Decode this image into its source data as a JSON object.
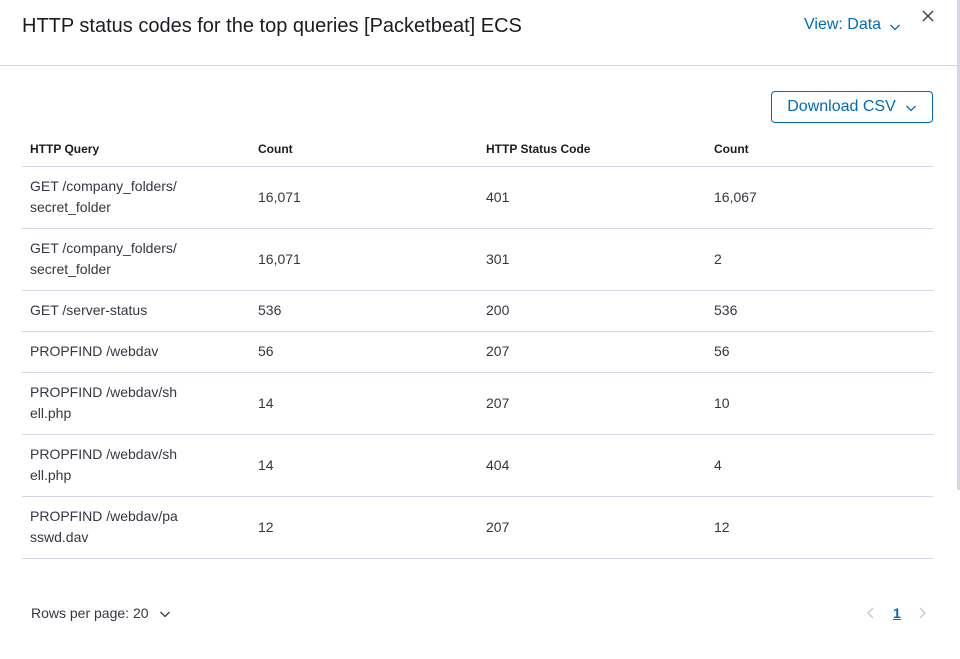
{
  "header": {
    "title": "HTTP status codes for the top queries [Packetbeat] ECS",
    "view_label": "View: Data",
    "close_icon": "close-icon",
    "chevron_icon": "chevron-down-icon"
  },
  "toolbar": {
    "download_label": "Download CSV"
  },
  "table": {
    "columns": [
      "HTTP Query",
      "Count",
      "HTTP Status Code",
      "Count"
    ],
    "rows": [
      [
        "GET /company_folders/secret_folder",
        "16,071",
        "401",
        "16,067"
      ],
      [
        "GET /company_folders/secret_folder",
        "16,071",
        "301",
        "2"
      ],
      [
        "GET /server-status",
        "536",
        "200",
        "536"
      ],
      [
        "PROPFIND /webdav",
        "56",
        "207",
        "56"
      ],
      [
        "PROPFIND /webdav/shell.php",
        "14",
        "207",
        "10"
      ],
      [
        "PROPFIND /webdav/shell.php",
        "14",
        "404",
        "4"
      ],
      [
        "PROPFIND /webdav/passwd.dav",
        "12",
        "207",
        "12"
      ]
    ]
  },
  "footer": {
    "rows_per_page_label": "Rows per page: 20",
    "current_page": "1"
  },
  "colors": {
    "accent": "#006bb8",
    "border": "#d3dae6",
    "text": "#343741"
  }
}
